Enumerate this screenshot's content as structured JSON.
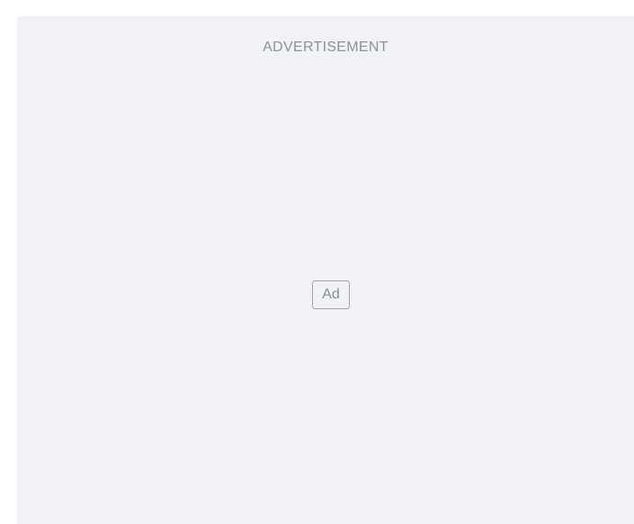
{
  "ad_slot": {
    "heading": "ADVERTISEMENT",
    "badge_label": "Ad"
  },
  "colors": {
    "panel_background": "#f1f2f5",
    "page_background": "#ffffff",
    "heading_text": "#8b909c",
    "badge_border": "#9ea3ae",
    "badge_text": "#868b97"
  }
}
